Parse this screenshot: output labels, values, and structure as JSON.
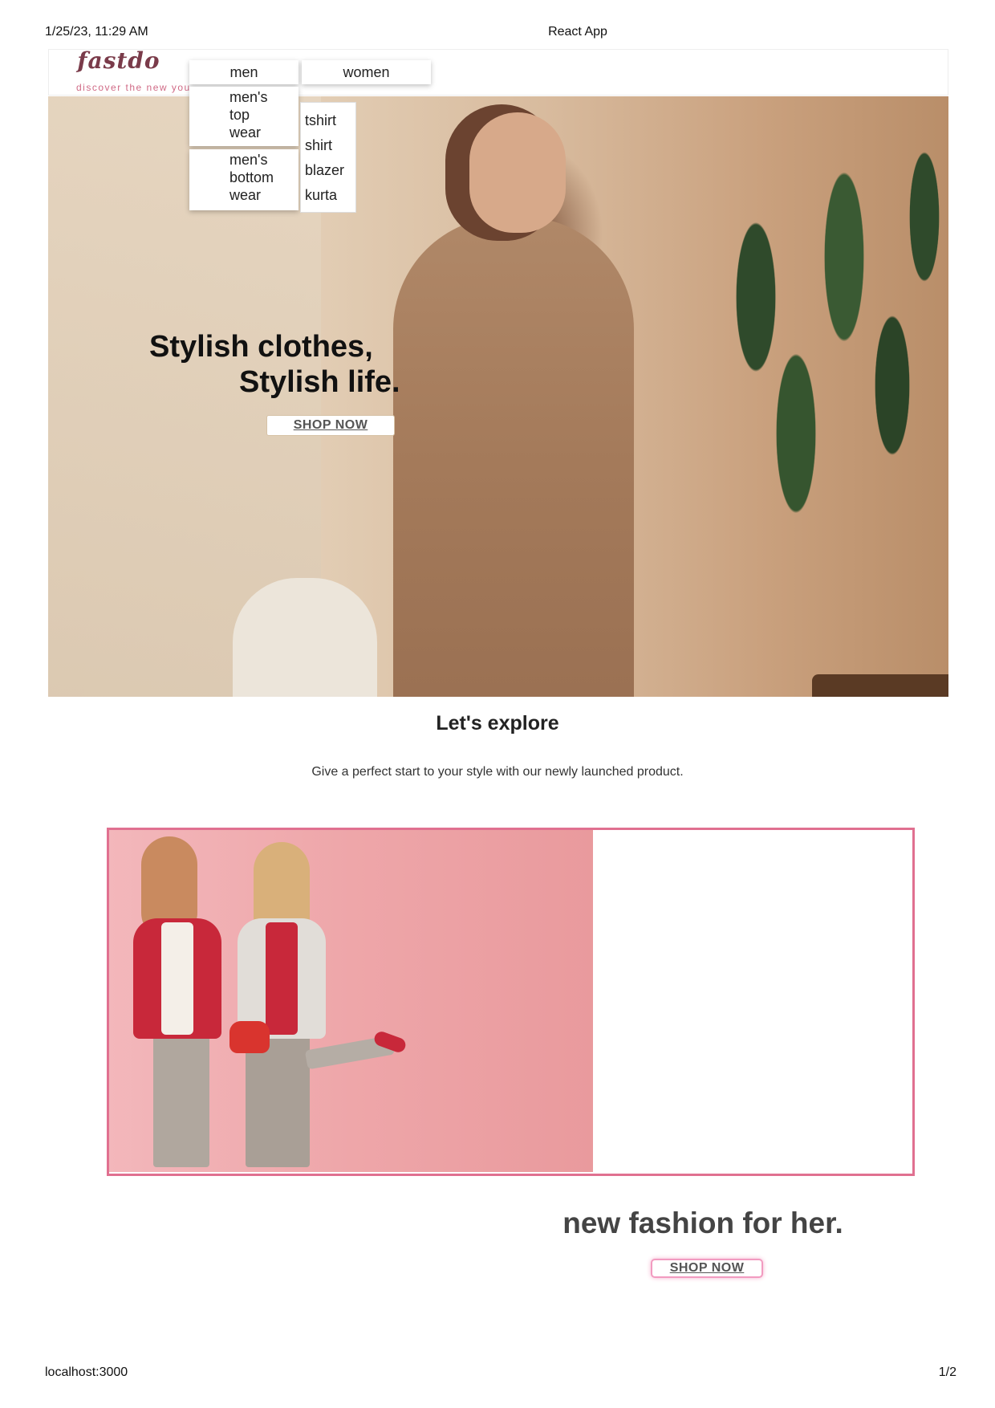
{
  "print_header": {
    "datetime": "1/25/23, 11:29 AM",
    "title": "React App"
  },
  "print_footer": {
    "url": "localhost:3000",
    "page": "1/2"
  },
  "logo": {
    "name": "fastdo",
    "tagline": "discover the new you"
  },
  "nav": {
    "menus": [
      {
        "label": "men"
      },
      {
        "label": "women"
      }
    ],
    "men_categories": [
      {
        "label": "men's top wear",
        "lines": [
          "men's",
          "top",
          "wear"
        ]
      },
      {
        "label": "men's bottom wear",
        "lines": [
          "men's",
          "bottom",
          "wear"
        ]
      }
    ],
    "top_wear_items": [
      "tshirt",
      "shirt",
      "blazer",
      "kurta"
    ]
  },
  "hero": {
    "title_line1": "Stylish clothes,",
    "title_line2": "Stylish life.",
    "cta_label": "SHOP NOW"
  },
  "explore": {
    "title": "Let's explore",
    "subtitle": "Give a perfect start to your style with our newly launched product."
  },
  "promo": {
    "heading": "new fashion for her.",
    "cta_label": "SHOP NOW",
    "border_color": "#e07090",
    "background_color": "#eea6a9"
  }
}
